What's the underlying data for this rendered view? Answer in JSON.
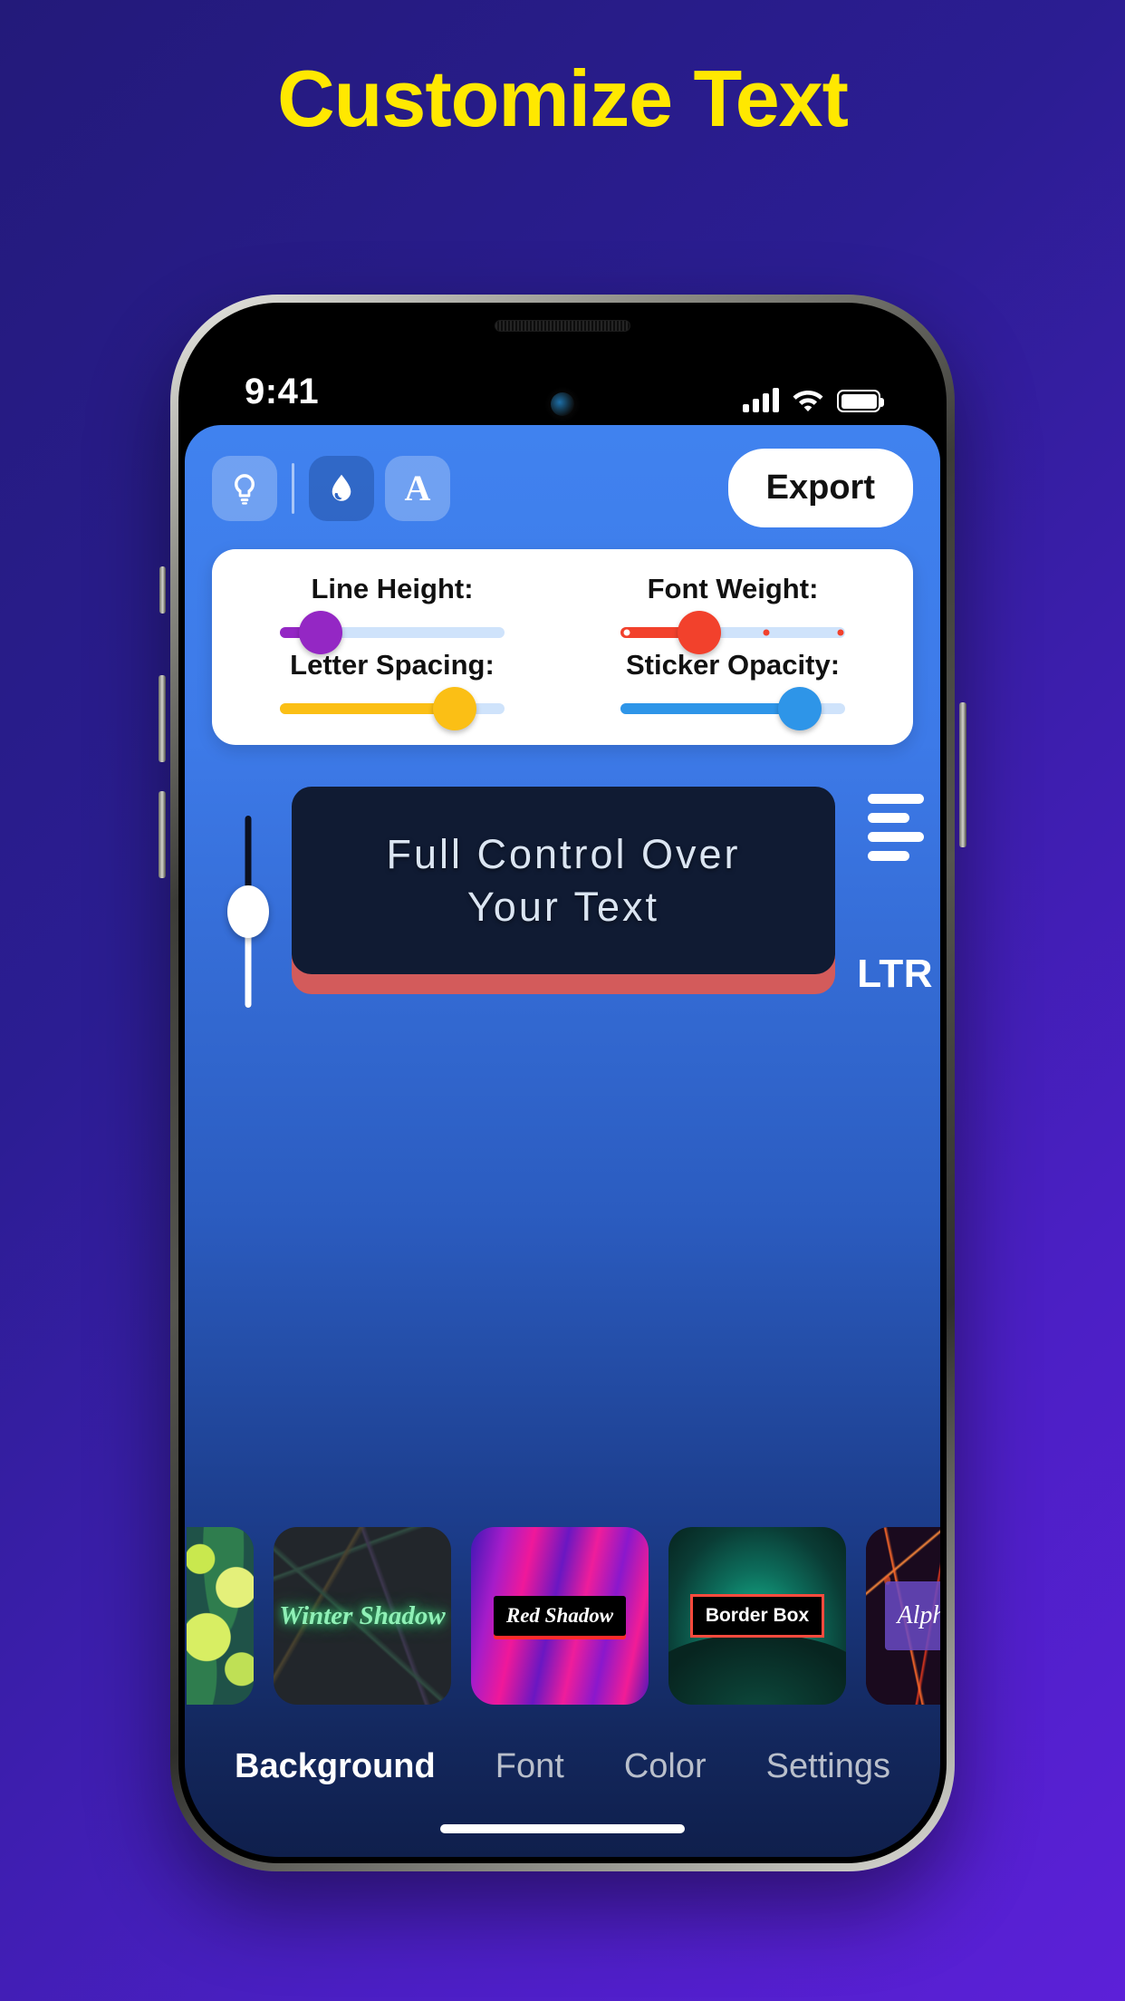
{
  "headline": "Customize Text",
  "status_bar": {
    "time": "9:41",
    "signal_icon": "cellular-signal-icon",
    "wifi_icon": "wifi-icon",
    "battery_icon": "battery-full-icon"
  },
  "toolbar": {
    "tools": [
      {
        "name": "lightbulb-icon",
        "label": "Effects",
        "active": false
      },
      {
        "name": "droplet-icon",
        "label": "Color Fill",
        "active": true
      },
      {
        "name": "letter-a-icon",
        "label": "A",
        "active": false
      }
    ],
    "export_label": "Export"
  },
  "panel": {
    "sliders": [
      {
        "label": "Line Height:",
        "color": "#9427c4",
        "value": 18,
        "ticks": []
      },
      {
        "label": "Font Weight:",
        "color": "#f2412c",
        "value": 35,
        "ticks": [
          3,
          65,
          98
        ]
      },
      {
        "label": "Letter Spacing:",
        "color": "#fbbf15",
        "value": 78,
        "ticks": []
      },
      {
        "label": "Sticker Opacity:",
        "color": "#2e95e8",
        "value": 80,
        "ticks": []
      }
    ]
  },
  "canvas": {
    "vertical_slider": {
      "name": "vertical-position-slider",
      "value": 50
    },
    "text_lines": [
      "Full Control Over",
      "Your Text"
    ],
    "align_icon": "text-align-icon",
    "direction_label": "LTR",
    "card_bg": "#101b33",
    "card_shadow": "#d35b5b"
  },
  "thumbnails": [
    {
      "id": "lemon",
      "label": "",
      "partial": "left"
    },
    {
      "id": "winter",
      "label": "Winter Shadow",
      "partial": ""
    },
    {
      "id": "red",
      "label": "Red Shadow",
      "partial": ""
    },
    {
      "id": "borderbox",
      "label": "Border Box",
      "partial": ""
    },
    {
      "id": "alpha",
      "label": "Alph",
      "partial": "right"
    }
  ],
  "tabs": [
    {
      "label": "Background",
      "active": true
    },
    {
      "label": "Font",
      "active": false
    },
    {
      "label": "Color",
      "active": false
    },
    {
      "label": "Settings",
      "active": false
    }
  ],
  "colors": {
    "page_bg_start": "#231a7a",
    "page_bg_end": "#5c20d8",
    "headline": "#ffe800",
    "app_top": "#4082ef",
    "app_bottom": "#0f1f4c"
  }
}
